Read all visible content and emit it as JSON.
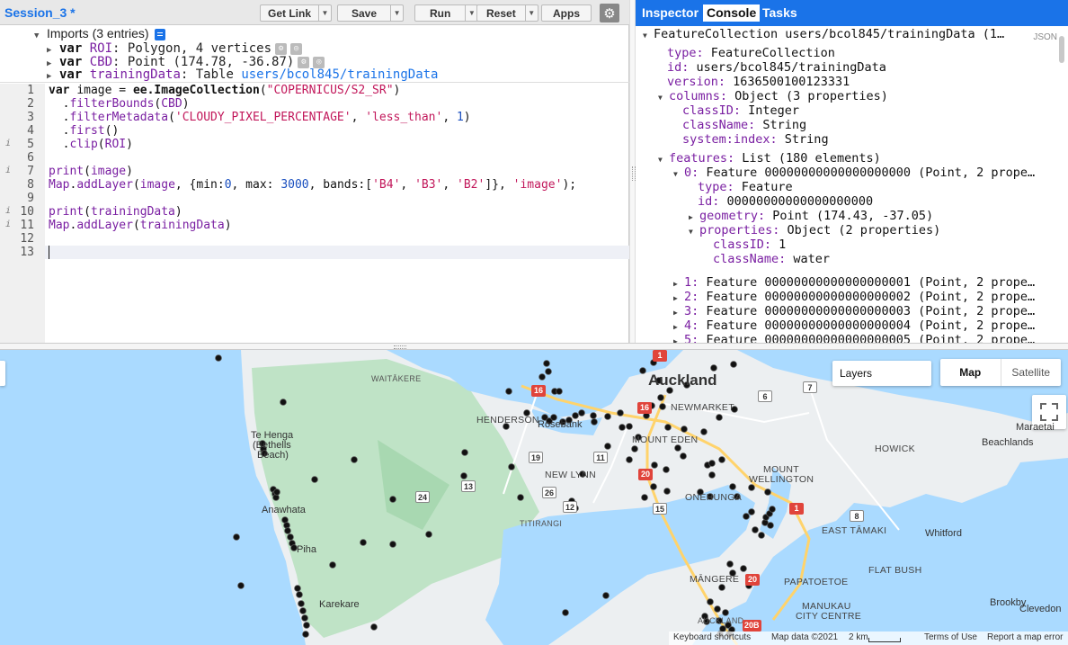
{
  "editor": {
    "session_title": "Session_3 *",
    "buttons": {
      "get_link": "Get Link",
      "save": "Save",
      "run": "Run",
      "reset": "Reset",
      "apps": "Apps"
    },
    "imports": {
      "header": "Imports (3 entries)",
      "rows": [
        {
          "kw": "var",
          "name": "ROI",
          "value": ": Polygon, 4 vertices"
        },
        {
          "kw": "var",
          "name": "CBD",
          "value": ": Point (174.78, -36.87)"
        },
        {
          "kw": "var",
          "name": "trainingData",
          "value": ": Table ",
          "path": "users/bcol845/trainingData"
        }
      ]
    },
    "line_numbers": [
      "1",
      "2",
      "3",
      "4",
      "5",
      "6",
      "7",
      "8",
      "9",
      "10",
      "11",
      "12",
      "13"
    ],
    "code": {
      "l1": [
        "var ",
        "image",
        " = ",
        "ee.ImageCollection",
        "(",
        "\"COPERNICUS/S2_SR\"",
        ")"
      ],
      "l2": [
        "  .",
        "filterBounds",
        "(",
        "CBD",
        ")"
      ],
      "l3": [
        "  .",
        "filterMetadata",
        "(",
        "'CLOUDY_PIXEL_PERCENTAGE'",
        ", ",
        "'less_than'",
        ", ",
        "1",
        ")"
      ],
      "l4": [
        "  .",
        "first",
        "()"
      ],
      "l5": [
        "  .",
        "clip",
        "(",
        "ROI",
        ")"
      ],
      "l7": [
        "print",
        "(",
        "image",
        ")"
      ],
      "l8": [
        "Map",
        ".",
        "addLayer",
        "(",
        "image",
        ", {min:",
        "0",
        ", max: ",
        "3000",
        ", bands:[",
        "'B4'",
        ", ",
        "'B3'",
        ", ",
        "'B2'",
        "]}, ",
        "'image'",
        ");"
      ],
      "l10": [
        "print",
        "(",
        "trainingData",
        ")"
      ],
      "l11": [
        "Map",
        ".",
        "addLayer",
        "(",
        "trainingData",
        ")"
      ]
    }
  },
  "console": {
    "tabs": [
      "Inspector",
      "Console",
      "Tasks"
    ],
    "json_label": "JSON",
    "rows": [
      {
        "key": "",
        "text": "FeatureCollection users/bcol845/trainingData (1…"
      },
      {
        "key": "type:",
        "text": " FeatureCollection"
      },
      {
        "key": "id:",
        "text": " users/bcol845/trainingData"
      },
      {
        "key": "version:",
        "text": " 1636500100123331"
      },
      {
        "key": "columns:",
        "text": " Object (3 properties)"
      },
      {
        "key": "classID:",
        "text": " Integer"
      },
      {
        "key": "className:",
        "text": " String"
      },
      {
        "key": "system:index:",
        "text": " String"
      },
      {
        "key": "features:",
        "text": " List (180 elements)"
      },
      {
        "key": "0:",
        "text": " Feature 00000000000000000000 (Point, 2 prope…"
      },
      {
        "key": "type:",
        "text": " Feature"
      },
      {
        "key": "id:",
        "text": " 00000000000000000000"
      },
      {
        "key": "geometry:",
        "text": " Point (174.43, -37.05)"
      },
      {
        "key": "properties:",
        "text": " Object (2 properties)"
      },
      {
        "key": "classID:",
        "text": " 1"
      },
      {
        "key": "className:",
        "text": " water"
      },
      {
        "key": "1:",
        "text": " Feature 00000000000000000001 (Point, 2 prope…"
      },
      {
        "key": "2:",
        "text": " Feature 00000000000000000002 (Point, 2 prope…"
      },
      {
        "key": "3:",
        "text": " Feature 00000000000000000003 (Point, 2 prope…"
      },
      {
        "key": "4:",
        "text": " Feature 00000000000000000004 (Point, 2 prope…"
      },
      {
        "key": "5:",
        "text": " Feature 00000000000000000005 (Point, 2 prope…"
      }
    ]
  },
  "map": {
    "layers_label": "Layers",
    "maptype": {
      "map": "Map",
      "satellite": "Satellite"
    },
    "labels": {
      "auckland": "Auckland",
      "waitakere": "WAITĀKERE",
      "henderson": "HENDERSON",
      "rosebank": "Rosebank",
      "newmarket": "NEWMARKET",
      "mount_eden": "MOUNT EDEN",
      "new_lynn": "NEW LYNN",
      "titirangi": "TITIRANGI",
      "te_henga": "Te Henga",
      "bethells": "(Bethells",
      "beach": "Beach)",
      "anawhata": "Anawhata",
      "piha": "Piha",
      "karekare": "Karekare",
      "onehunga": "ONEHUNGA",
      "mount": "MOUNT",
      "wellington": "WELLINGTON",
      "howick": "HOWICK",
      "beachlands": "Beachlands",
      "maraetai": "Maraetai",
      "east_tamaki": "EAST TĀMAKI",
      "whitford": "Whitford",
      "flat_bush": "FLAT BUSH",
      "mangere": "MĀNGERE",
      "papatoetoe": "PAPATOETOE",
      "manukau": "MANUKAU",
      "city_centre": "CITY CENTRE",
      "brookby": "Brookby",
      "clevedon": "Clevedon",
      "auckland_airport": "AUCKLAND"
    },
    "shields": {
      "s16a": "16",
      "s16b": "16",
      "s1": "1",
      "s20": "20",
      "s20b": "20",
      "s20B": "20B",
      "s7": "7",
      "s6": "6",
      "s19": "19",
      "s11": "11",
      "s13": "13",
      "s24": "24",
      "s26": "26",
      "s15": "15",
      "s8": "8",
      "s12": "12"
    },
    "attribution": {
      "keyboard": "Keyboard shortcuts",
      "mapdata": "Map data ©2021",
      "scale": "2 km",
      "terms": "Terms of Use",
      "report": "Report a map error"
    },
    "training_point_count_visible": 140
  }
}
